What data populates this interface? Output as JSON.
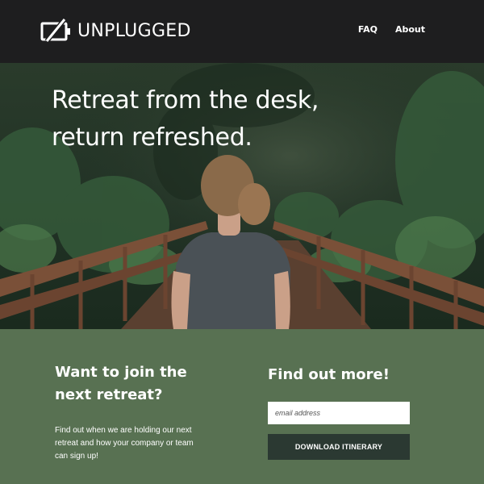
{
  "header": {
    "brand": "UNPLUGGED",
    "logo_icon": "battery-slash-icon",
    "nav": [
      {
        "label": "FAQ"
      },
      {
        "label": "About"
      }
    ]
  },
  "hero": {
    "title_line1": "Retreat from the desk,",
    "title_line2": "return refreshed."
  },
  "join": {
    "heading": "Want to join the next retreat?",
    "text": "Find out when we are holding our next retreat and how your company or team can sign up!"
  },
  "find_out": {
    "heading": "Find out more!",
    "email_placeholder": "email address",
    "button_label": "DOWNLOAD ITINERARY"
  },
  "colors": {
    "header_bg": "#1e1e1f",
    "cta_bg": "#587152",
    "button_bg": "#2b3932"
  }
}
